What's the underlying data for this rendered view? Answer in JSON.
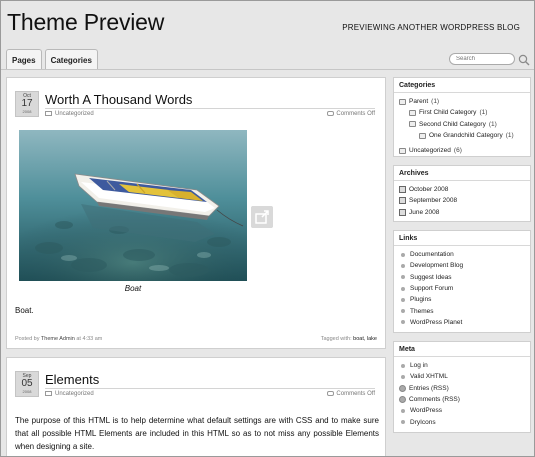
{
  "header": {
    "site_title": "Theme Preview",
    "tagline": "PREVIEWING ANOTHER WORDPRESS BLOG",
    "tabs": [
      "Pages",
      "Categories"
    ],
    "search_placeholder": "Search"
  },
  "posts": [
    {
      "month": "Oct",
      "day": "17",
      "year": "2008",
      "title": "Worth A Thousand Words",
      "category": "Uncategorized",
      "comments": "Comments Off",
      "caption": "Boat",
      "body": "Boat.",
      "posted_by_prefix": "Posted by",
      "author": "Theme Admin",
      "time": "at 4:33 am",
      "tagged_prefix": "Tagged with:",
      "tags": "boat, lake"
    },
    {
      "month": "Sep",
      "day": "05",
      "year": "2008",
      "title": "Elements",
      "category": "Uncategorized",
      "comments": "Comments Off",
      "body": "The purpose of this HTML is to help determine what default settings are with CSS and to make sure that all possible HTML Elements are included in this HTML so as to not miss any possible Elements when designing a site."
    }
  ],
  "sidebar": {
    "categories": {
      "title": "Categories",
      "items": [
        {
          "label": "Parent",
          "count": "(1)"
        },
        {
          "label": "First Child Category",
          "count": "(1)"
        },
        {
          "label": "Second Child Category",
          "count": "(1)"
        },
        {
          "label": "One Grandchild Category",
          "count": "(1)"
        },
        {
          "label": "Uncategorized",
          "count": "(6)"
        }
      ]
    },
    "archives": {
      "title": "Archives",
      "items": [
        "October 2008",
        "September 2008",
        "June 2008"
      ]
    },
    "links": {
      "title": "Links",
      "items": [
        "Documentation",
        "Development Blog",
        "Suggest Ideas",
        "Support Forum",
        "Plugins",
        "Themes",
        "WordPress Planet"
      ]
    },
    "meta": {
      "title": "Meta",
      "items": [
        "Log in",
        "Valid XHTML",
        "Entries (RSS)",
        "Comments (RSS)",
        "WordPress",
        "DryIcons"
      ]
    }
  }
}
